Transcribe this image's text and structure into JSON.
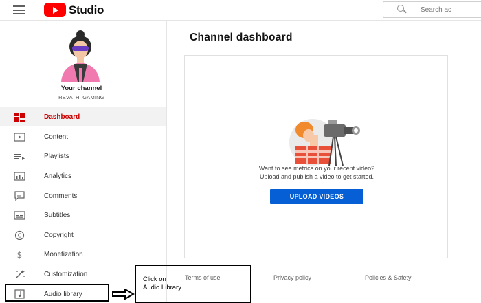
{
  "header": {
    "logo_text": "Studio",
    "search_placeholder": "Search ac"
  },
  "sidebar": {
    "channel_title": "Your channel",
    "channel_name": "REVATHI GAMING",
    "items": [
      {
        "label": "Dashboard",
        "icon": "dashboard-icon"
      },
      {
        "label": "Content",
        "icon": "content-icon"
      },
      {
        "label": "Playlists",
        "icon": "playlists-icon"
      },
      {
        "label": "Analytics",
        "icon": "analytics-icon"
      },
      {
        "label": "Comments",
        "icon": "comments-icon"
      },
      {
        "label": "Subtitles",
        "icon": "subtitles-icon"
      },
      {
        "label": "Copyright",
        "icon": "copyright-icon"
      },
      {
        "label": "Monetization",
        "icon": "monetization-icon"
      },
      {
        "label": "Customization",
        "icon": "customization-icon"
      },
      {
        "label": "Audio library",
        "icon": "audio-library-icon"
      }
    ]
  },
  "main": {
    "title": "Channel dashboard",
    "message_line1": "Want to see metrics on your recent video?",
    "message_line2": "Upload and publish a video to get started.",
    "upload_button": "UPLOAD VIDEOS"
  },
  "footer": {
    "terms": "Terms of use",
    "privacy": "Privacy policy",
    "policies": "Policies & Safety"
  },
  "annotation": {
    "line1": "Click on",
    "line2": "Audio Library"
  },
  "colors": {
    "brand_red": "#ff0000",
    "active_red": "#cc0000",
    "button_blue": "#065fd4"
  }
}
